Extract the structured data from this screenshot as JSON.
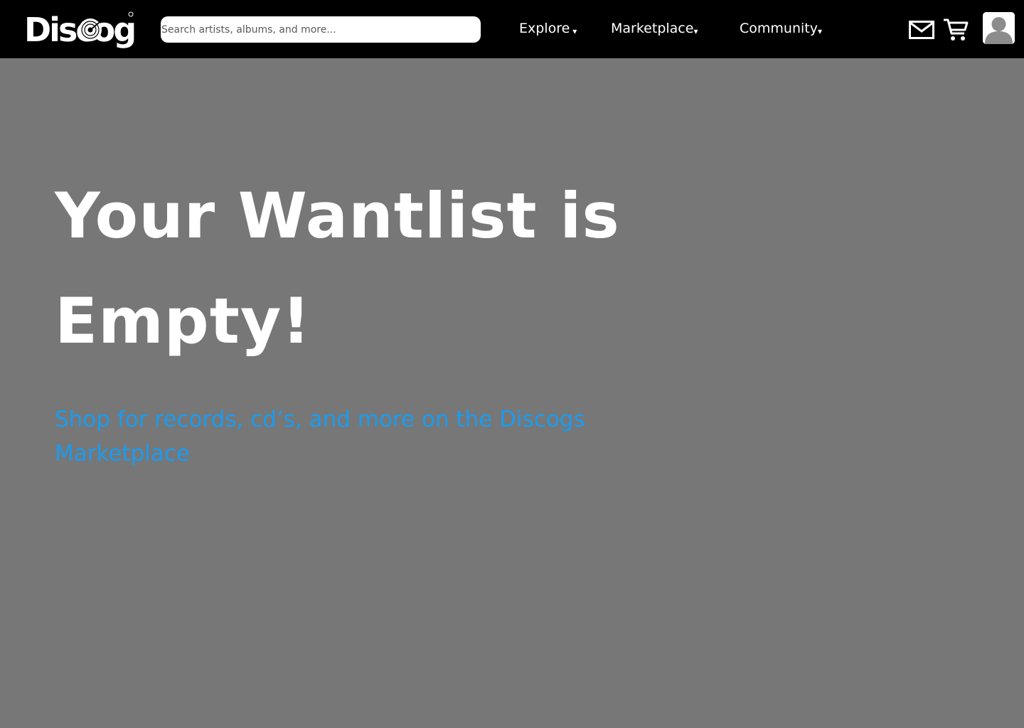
{
  "header": {
    "logo_text": "Discogs",
    "search": {
      "placeholder": "Search artists, albums, and more...",
      "value": ""
    },
    "nav": {
      "explore": "Explore",
      "marketplace": "Marketplace",
      "community": "Community",
      "caret": "▾"
    },
    "icons": [
      "mail-icon",
      "cart-icon",
      "user-avatar-icon"
    ]
  },
  "main": {
    "title": "Your Wantlist is Empty!",
    "shop_link": "Shop for records, cd’s, and more on the Discogs Marketplace"
  },
  "colors": {
    "header_bg": "#000000",
    "page_bg": "#777777",
    "link": "#1a9cf0",
    "text": "#ffffff"
  }
}
